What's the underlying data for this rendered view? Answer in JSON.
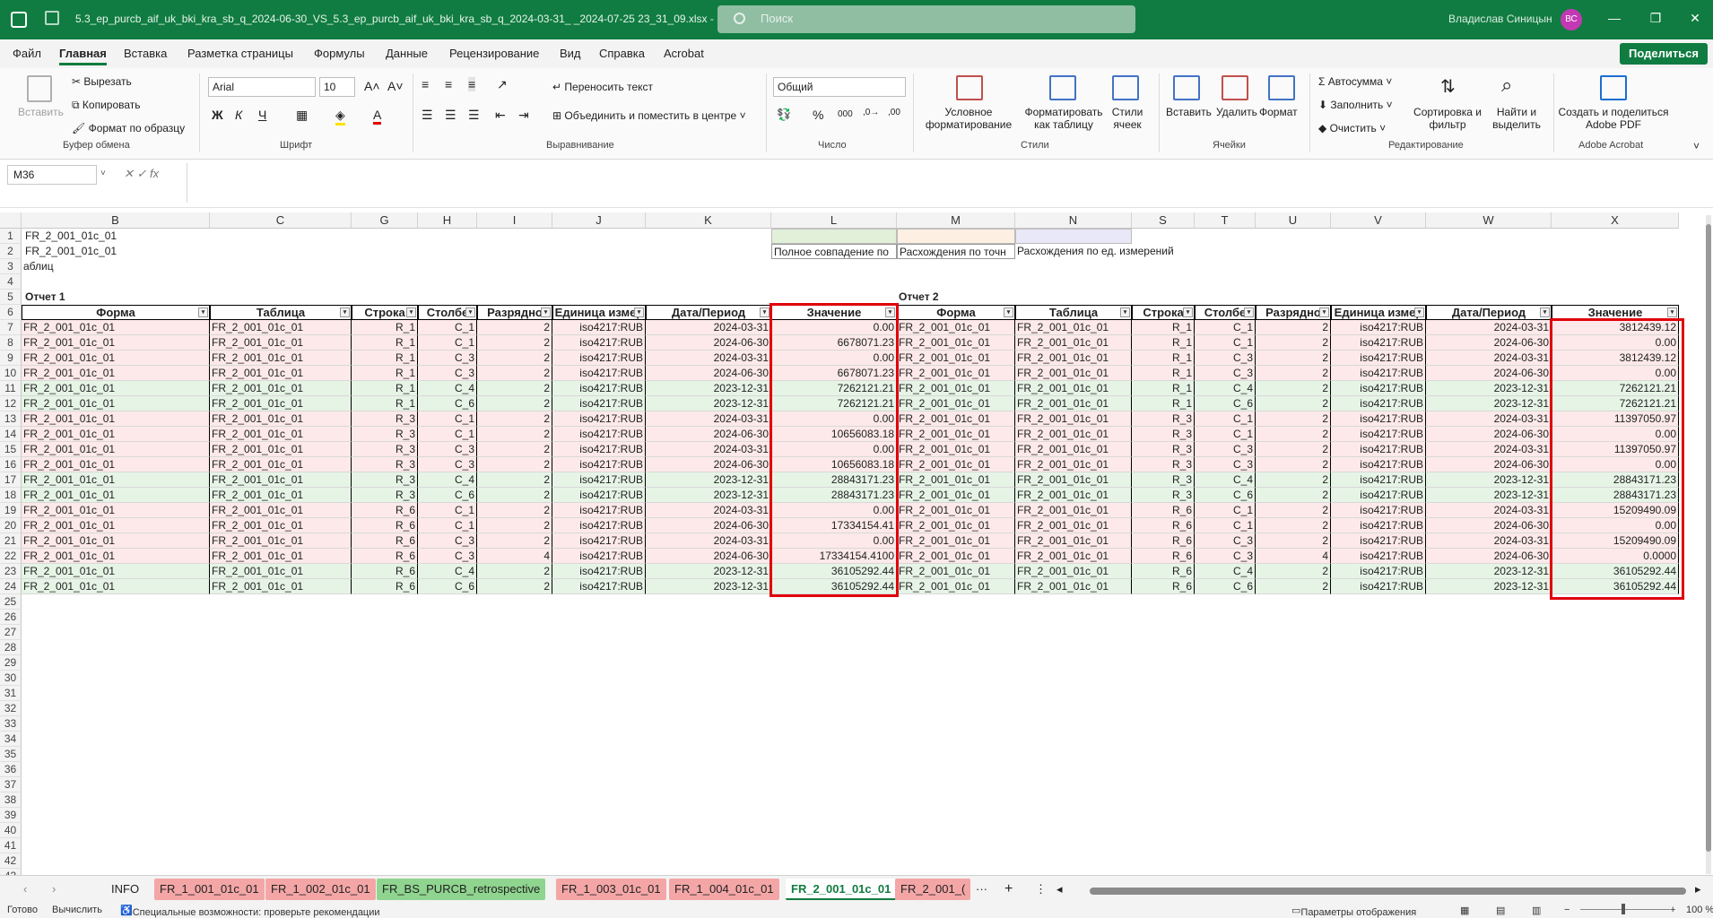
{
  "window": {
    "filename": "5.3_ep_purcb_aif_uk_bki_kra_sb_q_2024-06-30_VS_5.3_ep_purcb_aif_uk_bki_kra_sb_q_2024-03-31_ _2024-07-25 23_31_09.xlsx - Excel",
    "search": "Поиск",
    "user": "Владислав Синицын",
    "avatar": "ВС"
  },
  "menu": [
    "Файл",
    "Главная",
    "Вставка",
    "Разметка страницы",
    "Формулы",
    "Данные",
    "Рецензирование",
    "Вид",
    "Справка",
    "Acrobat"
  ],
  "share": "Поделиться",
  "ribbon": {
    "clipboard": {
      "paste": "Вставить",
      "cut": "Вырезать",
      "copy": "Копировать",
      "format_painter": "Формат по образцу",
      "group": "Буфер обмена"
    },
    "font": {
      "name": "Arial",
      "size": "10",
      "bold": "Ж",
      "italic": "К",
      "underline": "Ч",
      "group": "Шрифт"
    },
    "align": {
      "wrap": "Переносить текст",
      "merge": "Объединить и поместить в центре",
      "group": "Выравнивание"
    },
    "number": {
      "format": "Общий",
      "group": "Число"
    },
    "styles": {
      "cond": "Условное форматирование",
      "table": "Форматировать как таблицу",
      "cell": "Стили ячеек",
      "group": "Стили"
    },
    "cells": {
      "insert": "Вставить",
      "delete": "Удалить",
      "format": "Формат",
      "group": "Ячейки"
    },
    "editing": {
      "autosum": "Автосумма",
      "fill": "Заполнить",
      "clear": "Очистить",
      "sort": "Сортировка и фильтр",
      "find": "Найти и выделить",
      "group": "Редактирование"
    },
    "acrobat": {
      "create": "Создать и поделиться Adobe PDF",
      "group": "Adobe Acrobat"
    }
  },
  "formula_bar": {
    "name_box": "M36",
    "fx": "fx",
    "value": ""
  },
  "columns": [
    "B",
    "C",
    "G",
    "H",
    "I",
    "J",
    "K",
    "L",
    "M",
    "N",
    "S",
    "T",
    "U",
    "V",
    "W",
    "X"
  ],
  "rows": [
    "1",
    "2",
    "3",
    "4",
    "5",
    "6",
    "7",
    "8",
    "9",
    "10",
    "11",
    "12",
    "13",
    "14",
    "15",
    "16",
    "17",
    "18",
    "19",
    "20",
    "21",
    "22",
    "23",
    "24",
    "25",
    "26",
    "27",
    "28",
    "29",
    "30",
    "31",
    "32",
    "33",
    "34",
    "35",
    "36",
    "37",
    "38",
    "39",
    "40",
    "41",
    "42",
    "43"
  ],
  "top": {
    "b1": "FR_2_001_01c_01",
    "b2": "FR_2_001_01c_01",
    "b3": "аблиц",
    "legend_full": "Полное совпадение по",
    "legend_prec": "Расхождения по точн",
    "legend_unit": "Расхождения по ед. измерений",
    "report1": "Отчет 1",
    "report2": "Отчет 2"
  },
  "headers": [
    "Форма",
    "Таблица",
    "Строка",
    "Столбе",
    "Разрядно",
    "Единица измер",
    "Дата/Период",
    "Значение"
  ],
  "data": [
    {
      "row": "7",
      "form": "FR_2_001_01c_01",
      "table": "FR_2_001_01c_01",
      "str": "R_1",
      "col": "C_1",
      "dig": "2",
      "unit": "iso4217:RUB",
      "date1": "2024-03-31",
      "v1": "0.00",
      "date2": "2024-03-31",
      "v2": "3812439.12",
      "bg": "#fde9e9"
    },
    {
      "row": "8",
      "form": "FR_2_001_01c_01",
      "table": "FR_2_001_01c_01",
      "str": "R_1",
      "col": "C_1",
      "dig": "2",
      "unit": "iso4217:RUB",
      "date1": "2024-06-30",
      "v1": "6678071.23",
      "date2": "2024-06-30",
      "v2": "0.00",
      "bg": "#fde9e9"
    },
    {
      "row": "9",
      "form": "FR_2_001_01c_01",
      "table": "FR_2_001_01c_01",
      "str": "R_1",
      "col": "C_3",
      "dig": "2",
      "unit": "iso4217:RUB",
      "date1": "2024-03-31",
      "v1": "0.00",
      "date2": "2024-03-31",
      "v2": "3812439.12",
      "bg": "#fde9e9"
    },
    {
      "row": "10",
      "form": "FR_2_001_01c_01",
      "table": "FR_2_001_01c_01",
      "str": "R_1",
      "col": "C_3",
      "dig": "2",
      "unit": "iso4217:RUB",
      "date1": "2024-06-30",
      "v1": "6678071.23",
      "date2": "2024-06-30",
      "v2": "0.00",
      "bg": "#fde9e9"
    },
    {
      "row": "11",
      "form": "FR_2_001_01c_01",
      "table": "FR_2_001_01c_01",
      "str": "R_1",
      "col": "C_4",
      "dig": "2",
      "unit": "iso4217:RUB",
      "date1": "2023-12-31",
      "v1": "7262121.21",
      "date2": "2023-12-31",
      "v2": "7262121.21",
      "bg": "#e6f4e6"
    },
    {
      "row": "12",
      "form": "FR_2_001_01c_01",
      "table": "FR_2_001_01c_01",
      "str": "R_1",
      "col": "C_6",
      "dig": "2",
      "unit": "iso4217:RUB",
      "date1": "2023-12-31",
      "v1": "7262121.21",
      "date2": "2023-12-31",
      "v2": "7262121.21",
      "bg": "#e6f4e6"
    },
    {
      "row": "13",
      "form": "FR_2_001_01c_01",
      "table": "FR_2_001_01c_01",
      "str": "R_3",
      "col": "C_1",
      "dig": "2",
      "unit": "iso4217:RUB",
      "date1": "2024-03-31",
      "v1": "0.00",
      "date2": "2024-03-31",
      "v2": "11397050.97",
      "bg": "#fde9e9"
    },
    {
      "row": "14",
      "form": "FR_2_001_01c_01",
      "table": "FR_2_001_01c_01",
      "str": "R_3",
      "col": "C_1",
      "dig": "2",
      "unit": "iso4217:RUB",
      "date1": "2024-06-30",
      "v1": "10656083.18",
      "date2": "2024-06-30",
      "v2": "0.00",
      "bg": "#fde9e9"
    },
    {
      "row": "15",
      "form": "FR_2_001_01c_01",
      "table": "FR_2_001_01c_01",
      "str": "R_3",
      "col": "C_3",
      "dig": "2",
      "unit": "iso4217:RUB",
      "date1": "2024-03-31",
      "v1": "0.00",
      "date2": "2024-03-31",
      "v2": "11397050.97",
      "bg": "#fde9e9"
    },
    {
      "row": "16",
      "form": "FR_2_001_01c_01",
      "table": "FR_2_001_01c_01",
      "str": "R_3",
      "col": "C_3",
      "dig": "2",
      "unit": "iso4217:RUB",
      "date1": "2024-06-30",
      "v1": "10656083.18",
      "date2": "2024-06-30",
      "v2": "0.00",
      "bg": "#fde9e9"
    },
    {
      "row": "17",
      "form": "FR_2_001_01c_01",
      "table": "FR_2_001_01c_01",
      "str": "R_3",
      "col": "C_4",
      "dig": "2",
      "unit": "iso4217:RUB",
      "date1": "2023-12-31",
      "v1": "28843171.23",
      "date2": "2023-12-31",
      "v2": "28843171.23",
      "bg": "#e6f4e6"
    },
    {
      "row": "18",
      "form": "FR_2_001_01c_01",
      "table": "FR_2_001_01c_01",
      "str": "R_3",
      "col": "C_6",
      "dig": "2",
      "unit": "iso4217:RUB",
      "date1": "2023-12-31",
      "v1": "28843171.23",
      "date2": "2023-12-31",
      "v2": "28843171.23",
      "bg": "#e6f4e6"
    },
    {
      "row": "19",
      "form": "FR_2_001_01c_01",
      "table": "FR_2_001_01c_01",
      "str": "R_6",
      "col": "C_1",
      "dig": "2",
      "unit": "iso4217:RUB",
      "date1": "2024-03-31",
      "v1": "0.00",
      "date2": "2024-03-31",
      "v2": "15209490.09",
      "bg": "#fde9e9"
    },
    {
      "row": "20",
      "form": "FR_2_001_01c_01",
      "table": "FR_2_001_01c_01",
      "str": "R_6",
      "col": "C_1",
      "dig": "2",
      "unit": "iso4217:RUB",
      "date1": "2024-06-30",
      "v1": "17334154.41",
      "date2": "2024-06-30",
      "v2": "0.00",
      "bg": "#fde9e9"
    },
    {
      "row": "21",
      "form": "FR_2_001_01c_01",
      "table": "FR_2_001_01c_01",
      "str": "R_6",
      "col": "C_3",
      "dig": "2",
      "unit": "iso4217:RUB",
      "date1": "2024-03-31",
      "v1": "0.00",
      "date2": "2024-03-31",
      "v2": "15209490.09",
      "bg": "#fde9e9"
    },
    {
      "row": "22",
      "form": "FR_2_001_01c_01",
      "table": "FR_2_001_01c_01",
      "str": "R_6",
      "col": "C_3",
      "dig": "4",
      "unit": "iso4217:RUB",
      "date1": "2024-06-30",
      "v1": "17334154.4100",
      "date2": "2024-06-30",
      "v2": "0.0000",
      "bg": "#fde9e9"
    },
    {
      "row": "23",
      "form": "FR_2_001_01c_01",
      "table": "FR_2_001_01c_01",
      "str": "R_6",
      "col": "C_4",
      "dig": "2",
      "unit": "iso4217:RUB",
      "date1": "2023-12-31",
      "v1": "36105292.44",
      "date2": "2023-12-31",
      "v2": "36105292.44",
      "bg": "#e6f4e6"
    },
    {
      "row": "24",
      "form": "FR_2_001_01c_01",
      "table": "FR_2_001_01c_01",
      "str": "R_6",
      "col": "C_6",
      "dig": "2",
      "unit": "iso4217:RUB",
      "date1": "2023-12-31",
      "v1": "36105292.44",
      "date2": "2023-12-31",
      "v2": "36105292.44",
      "bg": "#e6f4e6"
    }
  ],
  "tabs": [
    {
      "label": "INFO",
      "bg": "#f3f3f3",
      "active": false
    },
    {
      "label": "FR_1_001_01c_01",
      "bg": "#f4a6a6",
      "active": false
    },
    {
      "label": "FR_1_002_01c_01",
      "bg": "#f4a6a6",
      "active": false
    },
    {
      "label": "FR_BS_PURCB_retrospective",
      "bg": "#8fd48f",
      "active": false
    },
    {
      "label": "FR_1_003_01c_01",
      "bg": "#f4a6a6",
      "active": false
    },
    {
      "label": "FR_1_004_01c_01",
      "bg": "#f4a6a6",
      "active": false
    },
    {
      "label": "FR_2_001_01c_01",
      "bg": "#ffffff",
      "active": true
    },
    {
      "label": "FR_2_001_(",
      "bg": "#f4a6a6",
      "active": false
    }
  ],
  "status": {
    "ready": "Готово",
    "calc": "Вычислить",
    "access": "Специальные возможности: проверьте рекомендации",
    "display": "Параметры отображения",
    "zoom": "100 %"
  },
  "colors": {
    "excel_green": "#107c41",
    "mismatch": "#fde9e9",
    "match": "#e6f4e6",
    "highlight": "#e0000b"
  }
}
